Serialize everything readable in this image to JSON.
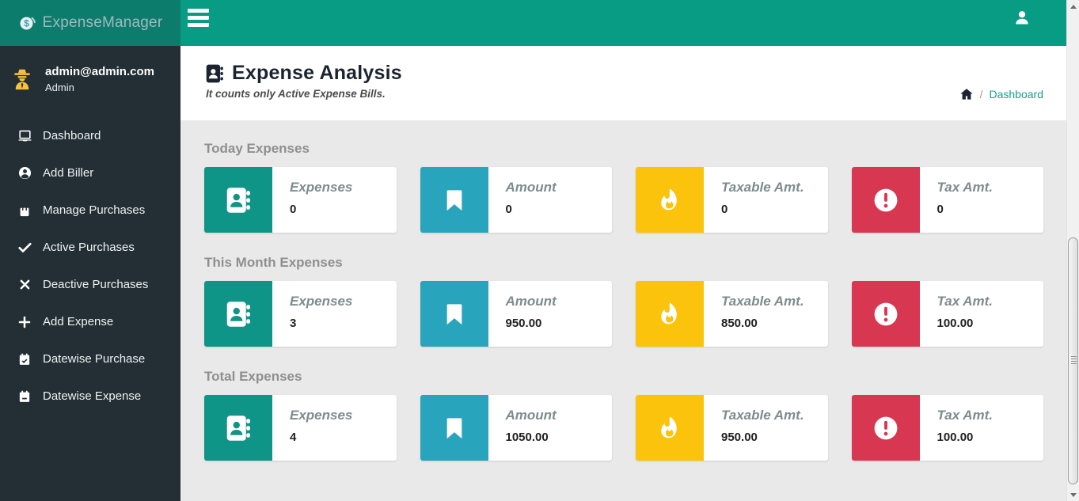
{
  "app": {
    "logo_text": "ExpenseManager"
  },
  "sidebar": {
    "user": {
      "email": "admin@admin.com",
      "role": "Admin"
    },
    "items": [
      {
        "label": "Dashboard",
        "icon": "laptop-icon"
      },
      {
        "label": "Add Biller",
        "icon": "user-circle-icon"
      },
      {
        "label": "Manage Purchases",
        "icon": "shopping-bag-icon"
      },
      {
        "label": "Active Purchases",
        "icon": "check-icon"
      },
      {
        "label": "Deactive Purchases",
        "icon": "times-icon"
      },
      {
        "label": "Add Expense",
        "icon": "plus-icon"
      },
      {
        "label": "Datewise Purchase",
        "icon": "calendar-check-icon"
      },
      {
        "label": "Datewise Expense",
        "icon": "calendar-minus-icon"
      }
    ]
  },
  "header": {
    "title": "Expense Analysis",
    "subtitle": "It counts only Active Expense Bills.",
    "breadcrumb": {
      "separator": "/",
      "current": "Dashboard"
    }
  },
  "sections": [
    {
      "title": "Today Expenses",
      "cards": [
        {
          "label": "Expenses",
          "value": "0",
          "icon": "address-book-icon",
          "color": "#0f9587"
        },
        {
          "label": "Amount",
          "value": "0",
          "icon": "bookmark-icon",
          "color": "#28a5bd"
        },
        {
          "label": "Taxable Amt.",
          "value": "0",
          "icon": "fire-icon",
          "color": "#fcc30c"
        },
        {
          "label": "Tax Amt.",
          "value": "0",
          "icon": "exclamation-circle-icon",
          "color": "#d73750"
        }
      ]
    },
    {
      "title": "This Month Expenses",
      "cards": [
        {
          "label": "Expenses",
          "value": "3",
          "icon": "address-book-icon",
          "color": "#0f9587"
        },
        {
          "label": "Amount",
          "value": "950.00",
          "icon": "bookmark-icon",
          "color": "#28a5bd"
        },
        {
          "label": "Taxable Amt.",
          "value": "850.00",
          "icon": "fire-icon",
          "color": "#fcc30c"
        },
        {
          "label": "Tax Amt.",
          "value": "100.00",
          "icon": "exclamation-circle-icon",
          "color": "#d73750"
        }
      ]
    },
    {
      "title": "Total Expenses",
      "cards": [
        {
          "label": "Expenses",
          "value": "4",
          "icon": "address-book-icon",
          "color": "#0f9587"
        },
        {
          "label": "Amount",
          "value": "1050.00",
          "icon": "bookmark-icon",
          "color": "#28a5bd"
        },
        {
          "label": "Taxable Amt.",
          "value": "950.00",
          "icon": "fire-icon",
          "color": "#fcc30c"
        },
        {
          "label": "Tax Amt.",
          "value": "100.00",
          "icon": "exclamation-circle-icon",
          "color": "#d73750"
        }
      ]
    }
  ],
  "colors": {
    "topbar": "#089c84",
    "sidebar_header": "#0c7c6c",
    "sidebar_bg": "#242f35",
    "content_bg": "#e9e9e9",
    "card_teal": "#0f9587",
    "card_blue": "#28a5bd",
    "card_yellow": "#fcc30c",
    "card_red": "#d73750",
    "breadcrumb_link": "#18a08b",
    "avatar_yellow": "#f6c23e"
  }
}
